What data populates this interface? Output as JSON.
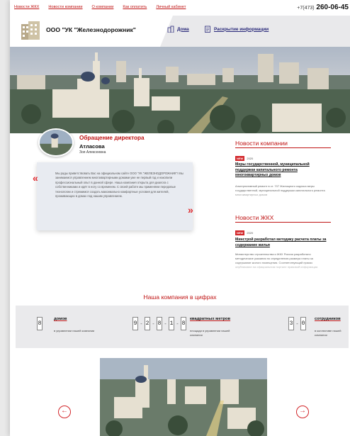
{
  "topnav": [
    "Новости ЖКХ",
    "Новости компании",
    "О компании",
    "Как оплатить",
    "Личный кабинет"
  ],
  "phone": {
    "code": "+7(473)",
    "number": "260-06-45"
  },
  "company_name": "ООО \"УК \"Железнодорожник\"",
  "header_nav": {
    "home": "Дома",
    "disclosure": "Раскрытие информации"
  },
  "director": {
    "title": "Обращение директора",
    "name": "Атласова",
    "first_name": "Зоя Алексеевна",
    "message": "Мы рады приветствовать Вас на официальном сайте ООО \"УК \"ЖЕЛЕЗНОДОРОЖНИК\"! Мы занимаемся управлением многоквартирными домами уже не первый год и накопили профессиональный опыт в данной сфере. Наша компания открыта для диалога с собственниками и идёт в ногу со временем. С своей работе мы применяем передовые технологии и стремимся создать максимально комфортные условия для жителей, проживающих в домах под нашим управлением."
  },
  "company_news": {
    "heading": "Новости компании",
    "badge": "NEW",
    "date": "2020",
    "title": "Меры государственной, муниципальной поддержки капитального ремонта многоквартирных домов",
    "text": "Альтернативный ремонт в ст. 707 Жилищного кодекса меры государственной, муниципальной поддержки капитального ремонта многоквартирных домов"
  },
  "zhkh_news": {
    "heading": "Новости ЖКХ",
    "badge": "NEW",
    "date": "2020",
    "title": "Минстрой разработал методику расчета платы за содержание жилья",
    "text": "Министерство строительства и ЖКХ России разработало методические указания по определению размера платы за содержание жилого помещения. Соответствующий приказ опубликован на официальном портале правовой информации."
  },
  "numbers": {
    "title": "Наша компания в цифрах",
    "houses": {
      "digits": [
        "8"
      ],
      "label": "домов",
      "sub": "в управлении нашей компании"
    },
    "area": {
      "digits": [
        "9",
        "2",
        "8",
        "1",
        "8"
      ],
      "label": "квадратных метров",
      "sub": "площади в управлении нашей компании"
    },
    "staff": {
      "digits": [
        "3",
        "0"
      ],
      "label": "сотрудников",
      "sub": "в коллективе нашей компании"
    }
  },
  "colors": {
    "accent": "#c01515",
    "header_bg": "#e9e9eb",
    "stats_bg": "#eaeaec"
  },
  "icons": {
    "gallery_prev": "arrow-left-icon",
    "gallery_next": "arrow-right-icon"
  }
}
